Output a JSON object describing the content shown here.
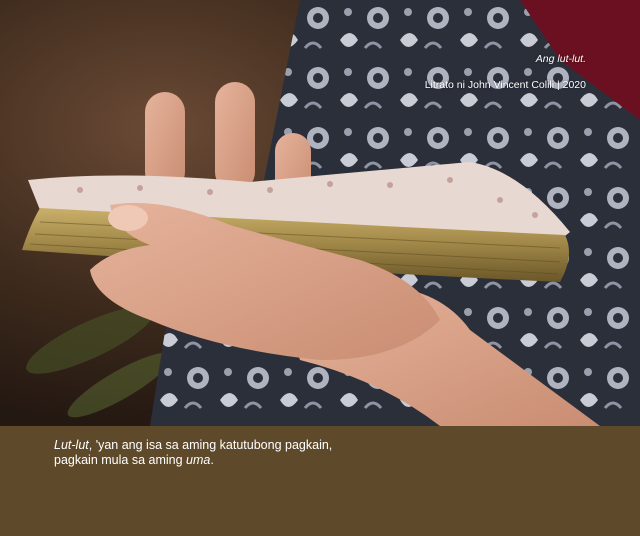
{
  "photo": {
    "subject_icon": "bamboo-rice-hand-photo",
    "colors": {
      "background_warm": "#3d2a1c",
      "cloth_dark": "#2b2f3a",
      "cloth_light": "#c9ccd4",
      "cloth_red": "#6b1020",
      "bamboo": "#a48a4a",
      "bamboo_dark": "#6a5728",
      "rice": "#e8d8d2",
      "skin": "#d9a38a"
    }
  },
  "caption": {
    "title": "Ang lut-lut.",
    "credit": "Litrato ni John Vincent Colili | 2020"
  },
  "description": {
    "line1_italic": "Lut-lut",
    "line1_rest": ", 'yan ang isa sa aming katutubong pagkain,",
    "line2_text": "pagkain mula sa aming ",
    "line2_italic": "uma",
    "line2_end": "."
  },
  "band_color": "#5e4a2b"
}
